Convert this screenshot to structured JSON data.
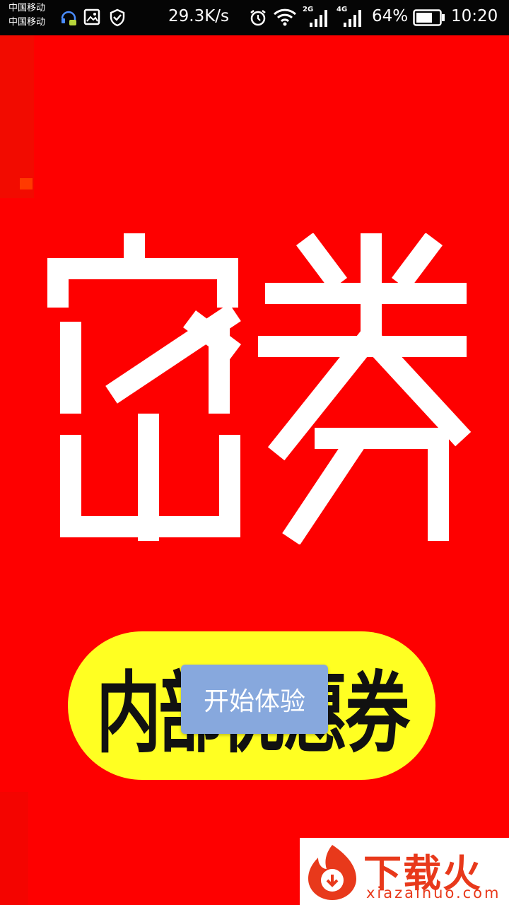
{
  "status_bar": {
    "carrier_1": "中国移动",
    "carrier_2": "中国移动",
    "network_speed": "29.3K/s",
    "sim1_network": "2G",
    "sim2_network": "4G",
    "battery_percent": "64%",
    "time": "10:20",
    "icons": [
      "headset-icon",
      "image-icon",
      "shield-icon",
      "alarm-icon",
      "wifi-icon",
      "signal-icon",
      "battery-icon"
    ]
  },
  "splash": {
    "logo_text": "密券",
    "slogan": "内部优惠券",
    "colors": {
      "background": "#fe0000",
      "logo": "#ffffff",
      "slogan_pill": "#ffff22",
      "slogan_text": "#111111"
    }
  },
  "start_button": {
    "label": "开始体验",
    "color": "#87a8dd"
  },
  "watermark": {
    "text": "下载火",
    "url": "xiazaihuo.com"
  }
}
